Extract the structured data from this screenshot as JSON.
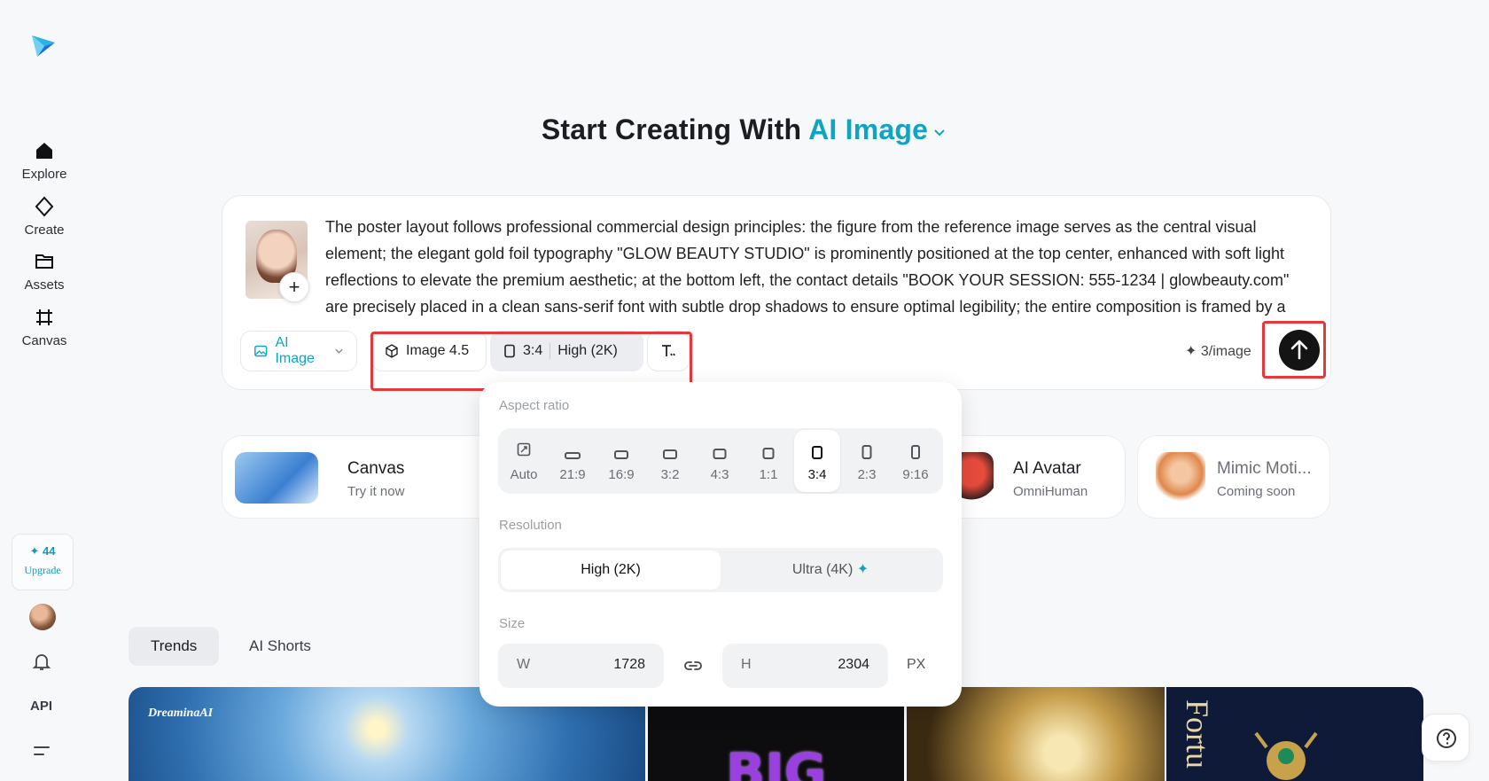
{
  "sidebar": {
    "nav": [
      {
        "label": "Explore",
        "icon": "home-icon"
      },
      {
        "label": "Create",
        "icon": "diamond-icon"
      },
      {
        "label": "Assets",
        "icon": "folder-icon"
      },
      {
        "label": "Canvas",
        "icon": "canvas-grid-icon"
      }
    ],
    "credits": "✦ 44",
    "upgrade": "Upgrade",
    "api": "API"
  },
  "headline": {
    "prefix": "Start Creating With",
    "accent": "AI Image"
  },
  "prompt": {
    "text": "The poster layout follows professional commercial design principles: the figure from the reference image serves as the central visual element; the elegant gold foil typography \"GLOW BEAUTY STUDIO\" is prominently positioned at the top center, enhanced with soft light reflections to elevate the premium aesthetic; at the bottom left, the contact details \"BOOK YOUR SESSION: 555-1234 | glowbeauty.com\" are precisely placed in a clean sans-serif font with subtle drop shadows to ensure optimal legibility; the entire composition is framed by a",
    "add_ref": "+",
    "mode": "AI Image",
    "model": "Image 4.5",
    "ratio": "3:4",
    "resolution": "High (2K)",
    "cost": "✦ 3/image"
  },
  "features": [
    {
      "title": "Canvas",
      "subtitle": "Try it now"
    },
    {
      "title": "AI Avatar",
      "subtitle": "OmniHuman"
    },
    {
      "title": "Mimic Moti...",
      "subtitle": "Coming soon"
    }
  ],
  "tabs": [
    "Trends",
    "AI Shorts"
  ],
  "gallery": {
    "brand": "DreaminaAI",
    "big": "BIG",
    "fortune": "Fortu"
  },
  "popover": {
    "aspect_label": "Aspect ratio",
    "ratios": [
      "Auto",
      "21:9",
      "16:9",
      "3:2",
      "4:3",
      "1:1",
      "3:4",
      "2:3",
      "9:16"
    ],
    "selected_ratio": "3:4",
    "resolution_label": "Resolution",
    "resolutions": [
      "High (2K)",
      "Ultra (4K)"
    ],
    "selected_resolution": "High (2K)",
    "size_label": "Size",
    "w_key": "W",
    "w_val": "1728",
    "h_key": "H",
    "h_val": "2304",
    "unit": "PX"
  },
  "colors": {
    "accent": "#12a3c0",
    "highlight": "#e5383b"
  }
}
